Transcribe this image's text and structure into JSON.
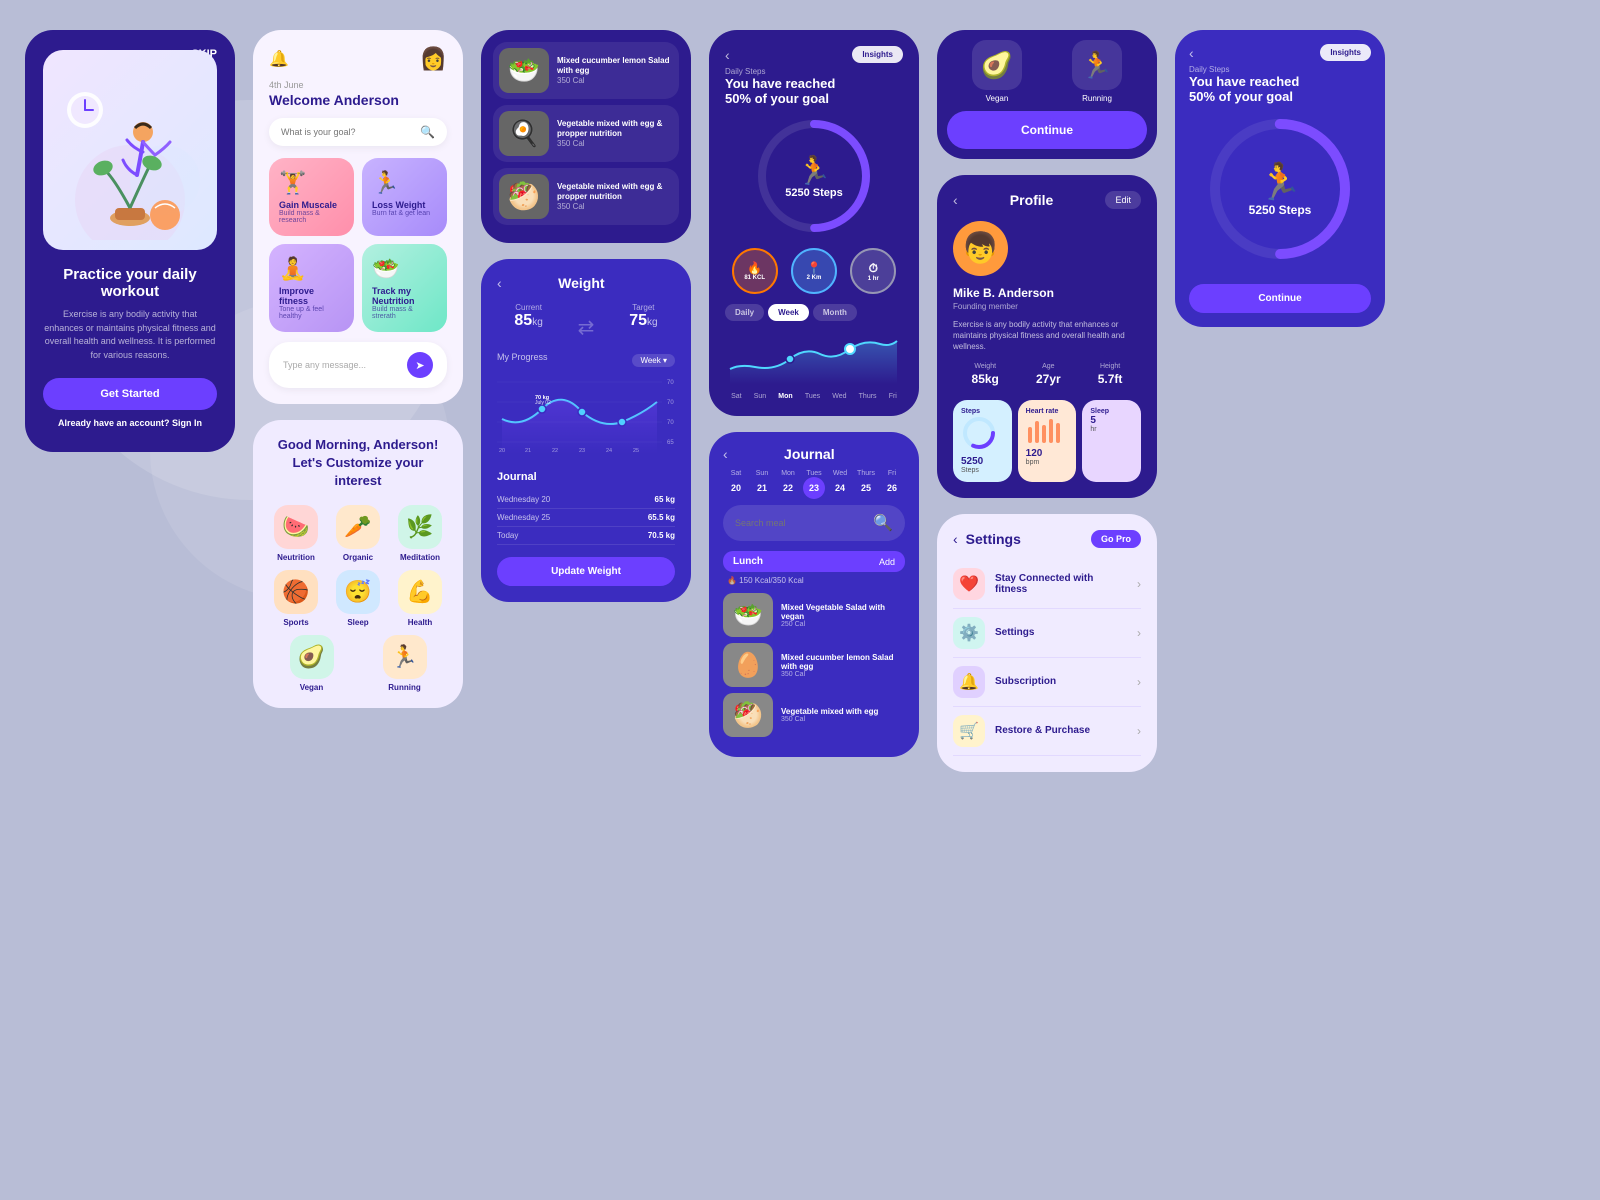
{
  "background": {
    "color": "#b8bdd6"
  },
  "onboarding": {
    "skip": "SKIP",
    "title": "Practice your daily workout",
    "description": "Exercise is any bodily activity that enhances or maintains physical fitness and overall health and wellness. It is performed for various reasons.",
    "cta": "Get Started",
    "signin_prompt": "Already have an account?",
    "signin_link": "Sign In"
  },
  "home": {
    "date": "4th June",
    "welcome": "Welcome Anderson",
    "search_placeholder": "What is your goal?",
    "goals": [
      {
        "icon": "🏋️",
        "title": "Gain Muscale",
        "sub": "Build mass & research",
        "color": "pink"
      },
      {
        "icon": "🏃",
        "title": "Loss Weight",
        "sub": "Burn fat & get lean",
        "color": "purple"
      },
      {
        "icon": "🧘",
        "title": "Improve fitness",
        "sub": "Tone up & feel healthy",
        "color": "lavender"
      },
      {
        "icon": "🥗",
        "title": "Track my Neutrition",
        "sub": "Build mass & strerath",
        "color": "mint"
      }
    ],
    "message_placeholder": "Type any message...",
    "send_icon": "➤"
  },
  "customize": {
    "greeting": "Good Morning, Anderson!",
    "subtitle": "Let's Customize your interest",
    "interests": [
      {
        "icon": "🍉",
        "label": "Neutrition",
        "color": "red"
      },
      {
        "icon": "🥕",
        "label": "Organic",
        "color": "orange"
      },
      {
        "icon": "🌿",
        "label": "Meditation",
        "color": "green"
      },
      {
        "icon": "🏀",
        "label": "Sports",
        "color": "orange2"
      },
      {
        "icon": "😴",
        "label": "Sleep",
        "color": "blue"
      },
      {
        "icon": "💪",
        "label": "Health",
        "color": "yellow"
      },
      {
        "icon": "🥑",
        "label": "Vegan",
        "color": "green"
      },
      {
        "icon": "🏃",
        "label": "Running",
        "color": "orange"
      }
    ]
  },
  "food_items": [
    {
      "icon": "🥗",
      "name": "Mixed cucumber lemon Salad with egg",
      "cal": "350 Cal"
    },
    {
      "icon": "🍳",
      "name": "Vegetable mixed with egg & propper nutrition",
      "cal": "350 Cal"
    },
    {
      "icon": "🥙",
      "name": "Mixed Vegetable Salad with vegan",
      "cal": "250 Cal"
    },
    {
      "icon": "🥚",
      "name": "Mixed cucumber lemon Salad with egg",
      "cal": "350 Cal"
    }
  ],
  "weight": {
    "title": "Weight",
    "current_label": "Current",
    "current_value": "85",
    "current_unit": "kg",
    "target_label": "Target",
    "target_value": "75",
    "target_unit": "kg",
    "progress_label": "My Progress",
    "week_label": "Week",
    "update_btn": "Update Weight",
    "journal_title": "Journal",
    "journal_rows": [
      {
        "date": "Wednesday 20",
        "value": "65 kg"
      },
      {
        "date": "Wednesday 25",
        "value": "65.5 kg"
      },
      {
        "date": "Today",
        "value": "70.5 kg"
      }
    ],
    "chart_labels": [
      "20",
      "21",
      "22",
      "23",
      "24",
      "25"
    ],
    "chart_y": [
      "70",
      "70",
      "70",
      "65"
    ]
  },
  "steps": {
    "daily_label": "Daily Steps",
    "headline": "You have reached\n50% of your goal",
    "count": "5250 Steps",
    "insights": "Insights",
    "stats": [
      {
        "label": "81 KCL",
        "icon": "🔥"
      },
      {
        "label": "2 Km",
        "icon": "📍"
      },
      {
        "label": "1 hr",
        "icon": "⏱"
      }
    ],
    "tabs": [
      "Daily",
      "Week",
      "Month"
    ],
    "active_tab": "Week",
    "days": [
      "Sat",
      "Sun",
      "Mon",
      "Tues",
      "Wed",
      "Thurs",
      "Fri"
    ],
    "back_arrow": "‹"
  },
  "journal_food": {
    "title": "Journal",
    "back_arrow": "‹",
    "days_row": [
      {
        "label": "Sat",
        "num": "20"
      },
      {
        "label": "Sun",
        "num": "21"
      },
      {
        "label": "Mon",
        "num": "22"
      },
      {
        "label": "Tues",
        "num": "23",
        "active": true
      },
      {
        "label": "Wed",
        "num": "24"
      },
      {
        "label": "Thurs",
        "num": "25"
      },
      {
        "label": "Fri",
        "num": "26"
      }
    ],
    "search_placeholder": "Search meal",
    "lunch_label": "Lunch",
    "add_label": "Add",
    "kcal": "🔥 150 Kcal/350 Kcal",
    "food_items": [
      {
        "icon": "🥗",
        "name": "Mixed Vegetable Salad with vegan",
        "cal": "250 Cal"
      },
      {
        "icon": "🥚",
        "name": "Mixed cucumber lemon Salad with egg",
        "cal": "350 Cal"
      },
      {
        "icon": "🥙",
        "name": "Vegetable mixed with egg",
        "cal": "350 Cal"
      }
    ]
  },
  "profile": {
    "title": "Profile",
    "edit_label": "Edit",
    "back_arrow": "‹",
    "name": "Mike B. Anderson",
    "role": "Founding member",
    "bio": "Exercise is any bodily activity that enhances or maintains physical fitness and overall health and wellness.",
    "stats": [
      {
        "label": "Weight",
        "value": "85kg"
      },
      {
        "label": "Age",
        "value": "27yr"
      },
      {
        "label": "Height",
        "value": "5.7ft"
      }
    ],
    "mini_cards": [
      {
        "label": "Steps",
        "value": "5250",
        "unit": "Steps",
        "color": "light-blue"
      },
      {
        "label": "Heart rate",
        "value": "120",
        "unit": "bpm",
        "color": "light-peach"
      },
      {
        "label": "Sleep",
        "value": "5",
        "unit": "hr",
        "color": "light-purple"
      }
    ]
  },
  "settings": {
    "title": "Settings",
    "go_pro": "Go Pro",
    "back_arrow": "‹",
    "items": [
      {
        "icon": "❤️",
        "label": "Stay Connected with fitness",
        "color": "pink"
      },
      {
        "icon": "⚙️",
        "label": "Settings",
        "color": "teal"
      },
      {
        "icon": "🔔",
        "label": "Subscription",
        "color": "purple"
      },
      {
        "icon": "🛒",
        "label": "Restore & Purchase",
        "color": "yellow"
      }
    ]
  },
  "top_food": {
    "items": [
      {
        "icon": "🥑",
        "label": "Vegan"
      },
      {
        "icon": "🏃",
        "label": "Running"
      }
    ],
    "continue_label": "Continue"
  },
  "steps_small": {
    "daily_label": "Daily Steps",
    "headline": "You have reached\n50% of your goal",
    "count": "5250 Steps",
    "insights": "Insights",
    "continue_label": "Continue"
  }
}
